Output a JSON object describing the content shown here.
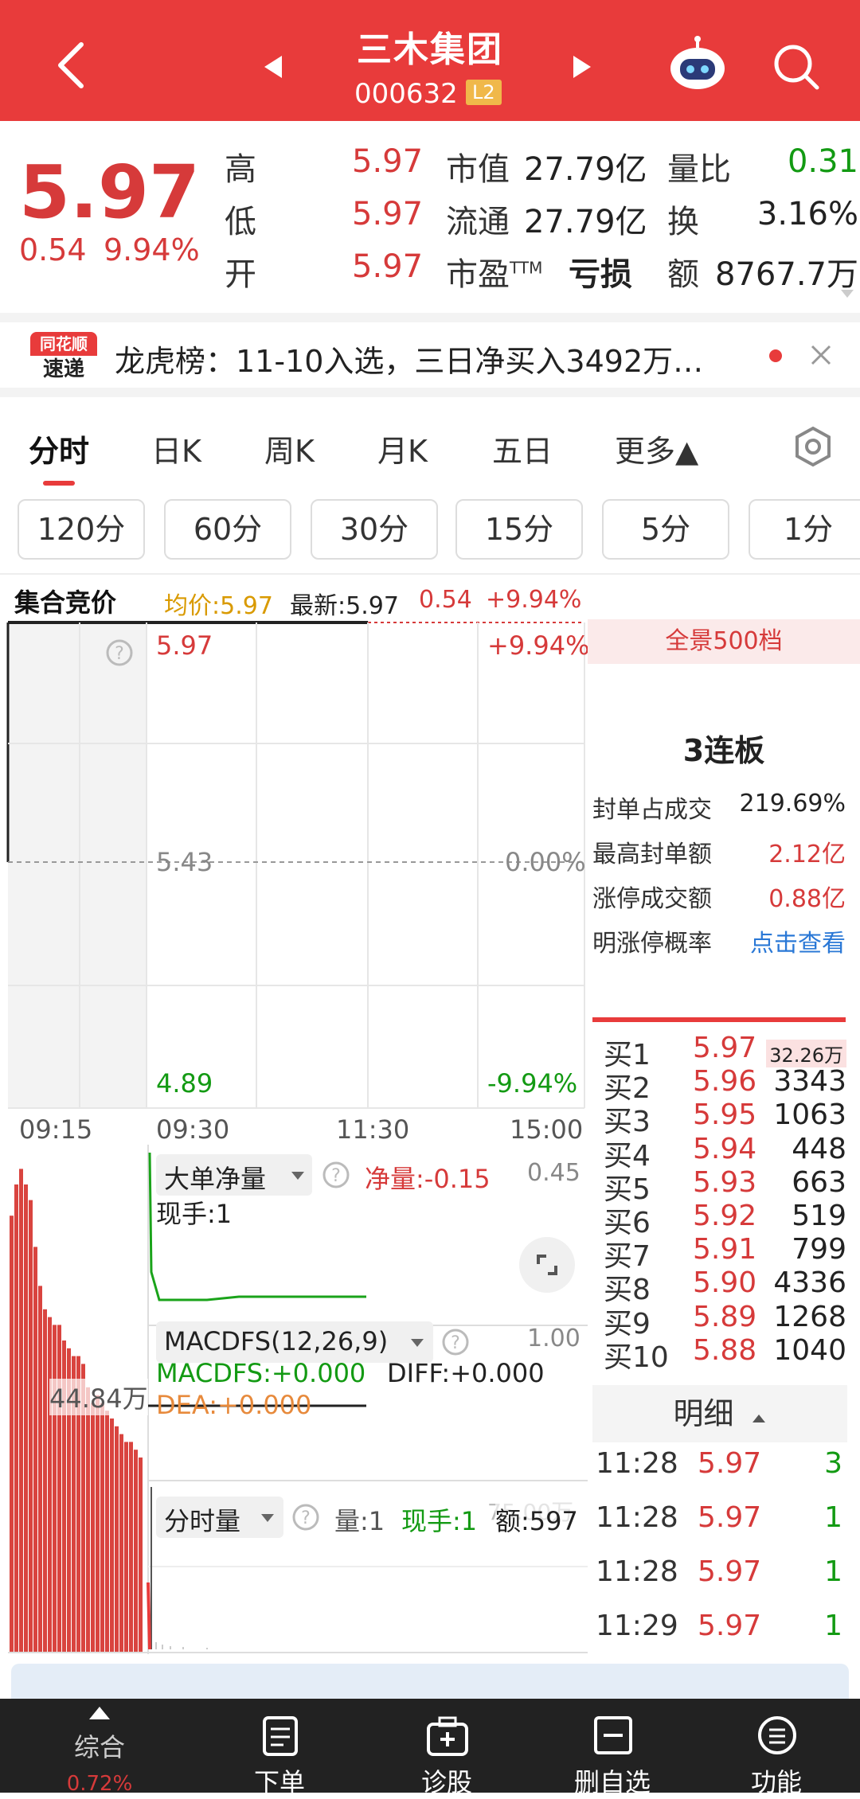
{
  "header": {
    "title": "三木集团",
    "code": "000632",
    "badge": "L2"
  },
  "quote": {
    "price": "5.97",
    "change": "0.54",
    "pct": "9.94%",
    "rows": [
      {
        "l1": "高",
        "v1": "5.97",
        "l2": "市值",
        "v2": "27.79亿",
        "l3": "量比",
        "v3": "0.31"
      },
      {
        "l1": "低",
        "v1": "5.97",
        "l2": "流通",
        "v2": "27.79亿",
        "l3": "换",
        "v3": "3.16%"
      },
      {
        "l1": "开",
        "v1": "5.97",
        "l2": "市盈",
        "l2sup": "TTM",
        "v2": "亏损",
        "l3": "额",
        "v3": "8767.7万"
      }
    ]
  },
  "news": {
    "logo_top": "同花顺",
    "logo_bottom": "速递",
    "text": "龙虎榜：11-10入选，三日净买入3492万…"
  },
  "tabs": [
    "分时",
    "日K",
    "周K",
    "月K",
    "五日",
    "更多▲"
  ],
  "periods": [
    "120分",
    "60分",
    "30分",
    "15分",
    "5分",
    "1分"
  ],
  "chart_header": {
    "label": "集合竞价",
    "avg": "均价:5.97",
    "latest": "最新:5.97",
    "chg": "0.54",
    "pct": "+9.94%"
  },
  "chart": {
    "top_price": "5.97",
    "top_pct": "+9.94%",
    "mid_price": "5.43",
    "mid_pct": "0.00%",
    "bot_price": "4.89",
    "bot_pct": "-9.94%",
    "times": [
      "09:15",
      "09:30",
      "11:30",
      "15:00"
    ],
    "left_vol": "44.84万"
  },
  "indicators": {
    "dadan": {
      "name": "大单净量",
      "net": "净量:-0.15",
      "max": "0.45",
      "hand": "现手:1"
    },
    "macd": {
      "name": "MACDFS(12,26,9)",
      "max": "1.00",
      "macdfs": "MACDFS:+0.000",
      "diff": "DIFF:+0.000",
      "dea": "DEA:+0.000"
    },
    "vol": {
      "name": "分时量",
      "qty": "量:1",
      "hand": "现手:1",
      "amt": "额:597",
      "overlay": "75.00万"
    }
  },
  "right": {
    "title": "全景500档",
    "board": "3连板",
    "items": [
      {
        "k": "封单占成交",
        "v": "219.69%"
      },
      {
        "k": "最高封单额",
        "v": "2.12亿"
      },
      {
        "k": "涨停成交额",
        "v": "0.88亿"
      },
      {
        "k": "明涨停概率",
        "v": "点击查看"
      }
    ],
    "buys": [
      {
        "l": "买1",
        "p": "5.97",
        "v": "32.26万"
      },
      {
        "l": "买2",
        "p": "5.96",
        "v": "3343"
      },
      {
        "l": "买3",
        "p": "5.95",
        "v": "1063"
      },
      {
        "l": "买4",
        "p": "5.94",
        "v": "448"
      },
      {
        "l": "买5",
        "p": "5.93",
        "v": "663"
      },
      {
        "l": "买6",
        "p": "5.92",
        "v": "519"
      },
      {
        "l": "买7",
        "p": "5.91",
        "v": "799"
      },
      {
        "l": "买8",
        "p": "5.90",
        "v": "4336"
      },
      {
        "l": "买9",
        "p": "5.89",
        "v": "1268"
      },
      {
        "l": "买10",
        "p": "5.88",
        "v": "1040"
      }
    ],
    "detail_title": "明细",
    "details": [
      {
        "t": "11:28",
        "p": "5.97",
        "v": "3"
      },
      {
        "t": "11:28",
        "p": "5.97",
        "v": "1"
      },
      {
        "t": "11:28",
        "p": "5.97",
        "v": "1"
      },
      {
        "t": "11:29",
        "p": "5.97",
        "v": "1"
      }
    ]
  },
  "bottom": {
    "pct": "0.72%",
    "items": [
      "综合",
      "下单",
      "诊股",
      "删自选",
      "功能"
    ]
  }
}
